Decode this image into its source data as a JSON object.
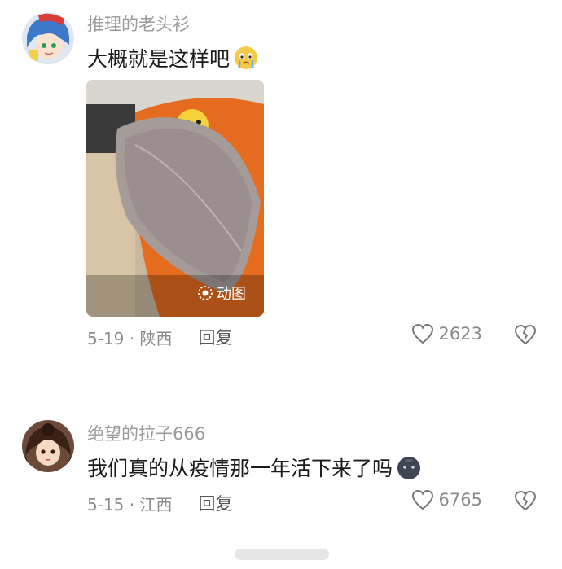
{
  "comments": [
    {
      "username": "推理的老头衫",
      "text": "大概就是这样吧",
      "emoji": "cry-face-icon",
      "media": {
        "badge": "动图"
      },
      "date_location": "5-19 · 陕西",
      "reply_label": "回复",
      "likes": "2623"
    },
    {
      "username": "绝望的拉子666",
      "text": "我们真的从疫情那一年活下来了吗",
      "emoji": "dark-blob-face-icon",
      "date_location": "5-15 · 江西",
      "reply_label": "回复",
      "likes": "6765"
    }
  ],
  "colors": {
    "meta_gray": "#8a8a8a",
    "text": "#1a1a1a",
    "background": "#ffffff"
  }
}
